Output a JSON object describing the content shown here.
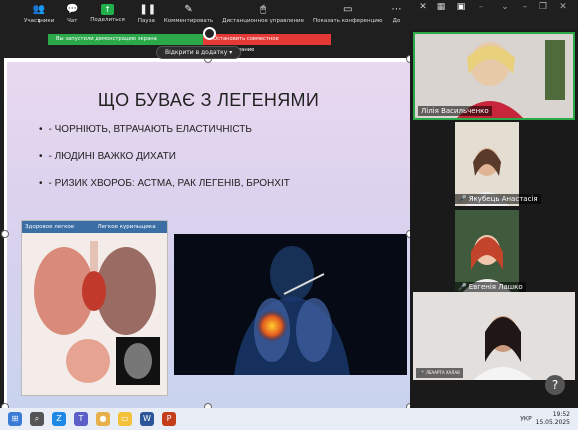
{
  "toolbar": {
    "participants_count": "4",
    "participants": "Участники",
    "chat": "Чат",
    "share": "Поделиться",
    "pause": "Пауза",
    "annotate": "Комментировать",
    "remote": "Дистанционное управление",
    "show_conf": "Показать конференцию",
    "more": "До"
  },
  "banner": {
    "sharing": "Вы запустили демонстрацию экрана",
    "stop": "Остановить совместное использование"
  },
  "open_in_app": "Відкрити в додатку",
  "slide": {
    "title": "ЩО БУВАЄ З ЛЕГЕНЯМИ",
    "bullets": [
      "- ЧОРНІЮТЬ, ВТРАЧАЮТЬ ЕЛАСТИЧНІСТЬ",
      "- ЛЮДИНІ ВАЖКО ДИХАТИ",
      "- РИЗИК ХВОРОБ: АСТМА, РАК ЛЕГЕНІВ, БРОНХІТ"
    ],
    "img_left_labels": [
      "Здоровое легкое",
      "Легкое курильщика"
    ]
  },
  "participants": [
    {
      "name": "Лілія Васильченко",
      "muted": false
    },
    {
      "name": "Якубець Анастасія",
      "muted": true
    },
    {
      "name": "Евгенія Лашко",
      "muted": true
    },
    {
      "name": "ЛЕААРТА ХАЛАВ",
      "muted": true
    }
  ],
  "help": "?",
  "tray": {
    "lang": "УКР",
    "time": "19:52",
    "date": "15.05.2025"
  },
  "colors": {
    "share_green": "#2ba84a",
    "stop_red": "#e53935"
  }
}
